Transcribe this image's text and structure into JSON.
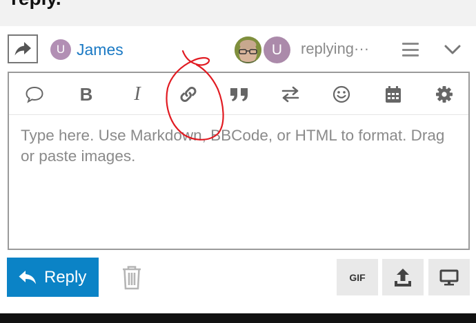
{
  "page_heading": "reply.",
  "composer": {
    "reply_icon": "share-arrow-icon",
    "recipient": {
      "avatar_letter": "U",
      "name": "James"
    },
    "presence": {
      "second_avatar_letter": "U",
      "status_text": "replying···"
    },
    "menu_icon": "hamburger-icon",
    "collapse_icon": "chevron-down-icon"
  },
  "toolbar": {
    "items": [
      {
        "icon": "speech-bubble-icon"
      },
      {
        "icon": "bold-icon",
        "glyph": "B"
      },
      {
        "icon": "italic-icon",
        "glyph": "I"
      },
      {
        "icon": "link-icon"
      },
      {
        "icon": "quote-icon"
      },
      {
        "icon": "swap-arrows-icon"
      },
      {
        "icon": "smiley-icon"
      },
      {
        "icon": "calendar-icon"
      },
      {
        "icon": "gear-icon"
      }
    ]
  },
  "editor": {
    "placeholder": "Type here. Use Markdown, BBCode, or HTML to format. Drag or paste images."
  },
  "actions": {
    "reply_label": "Reply",
    "reply_icon": "reply-arrow-icon",
    "discard_icon": "trash-icon",
    "gif_label": "GIF",
    "upload_icon": "upload-icon",
    "preview_icon": "monitor-icon"
  },
  "colors": {
    "accent": "#0b83c6",
    "link_blue": "#1a79c4",
    "avatar_purple": "#b28fb4",
    "annotation_red": "#e11b22"
  }
}
